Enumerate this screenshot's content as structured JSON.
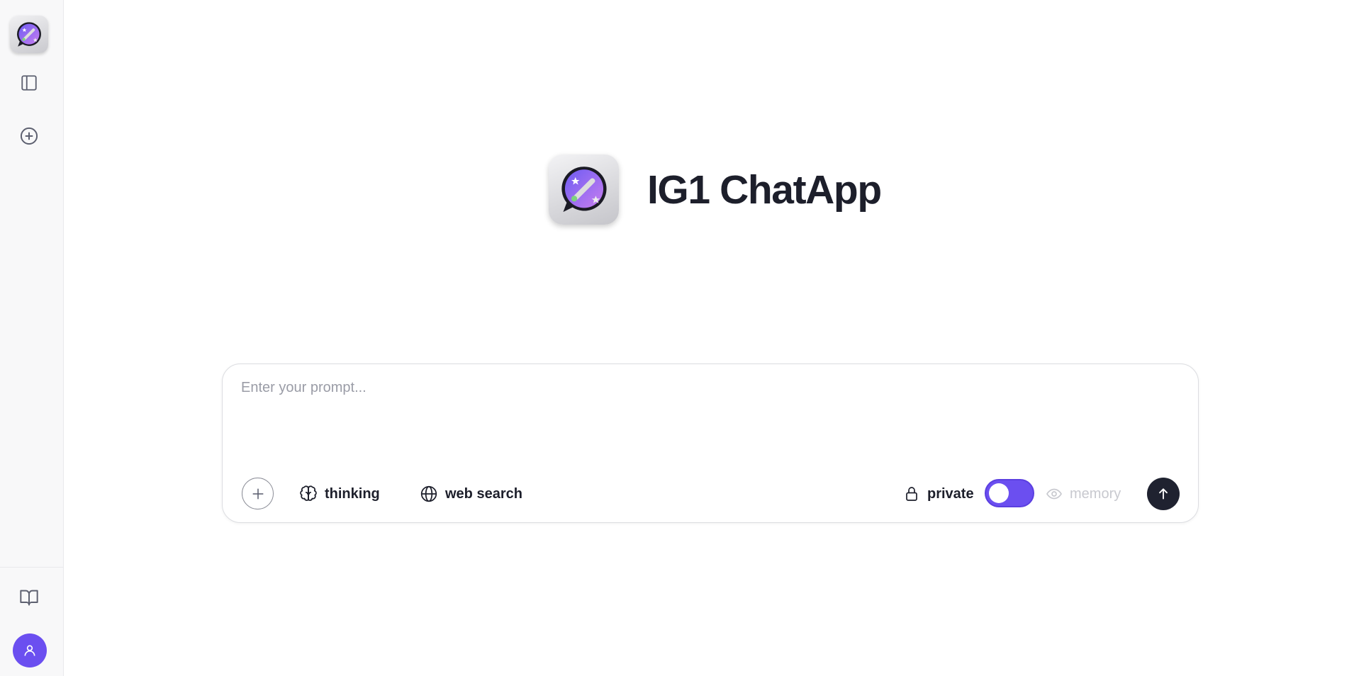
{
  "app": {
    "title": "IG1 ChatApp",
    "logo_icon": "magic-wand-chat-bubble-icon",
    "brand_color": "#6b4ff0"
  },
  "sidebar": {
    "items": [
      {
        "name": "toggle-sidebar",
        "icon": "sidebar-panel-icon"
      },
      {
        "name": "new-chat",
        "icon": "plus-circle-icon"
      },
      {
        "name": "docs",
        "icon": "book-open-icon"
      },
      {
        "name": "profile",
        "icon": "user-icon"
      }
    ]
  },
  "composer": {
    "placeholder": "Enter your prompt...",
    "value": "",
    "tools": {
      "thinking_label": "thinking",
      "web_search_label": "web search"
    },
    "private_label": "private",
    "private_enabled": true,
    "memory_label": "memory",
    "memory_enabled": false
  }
}
